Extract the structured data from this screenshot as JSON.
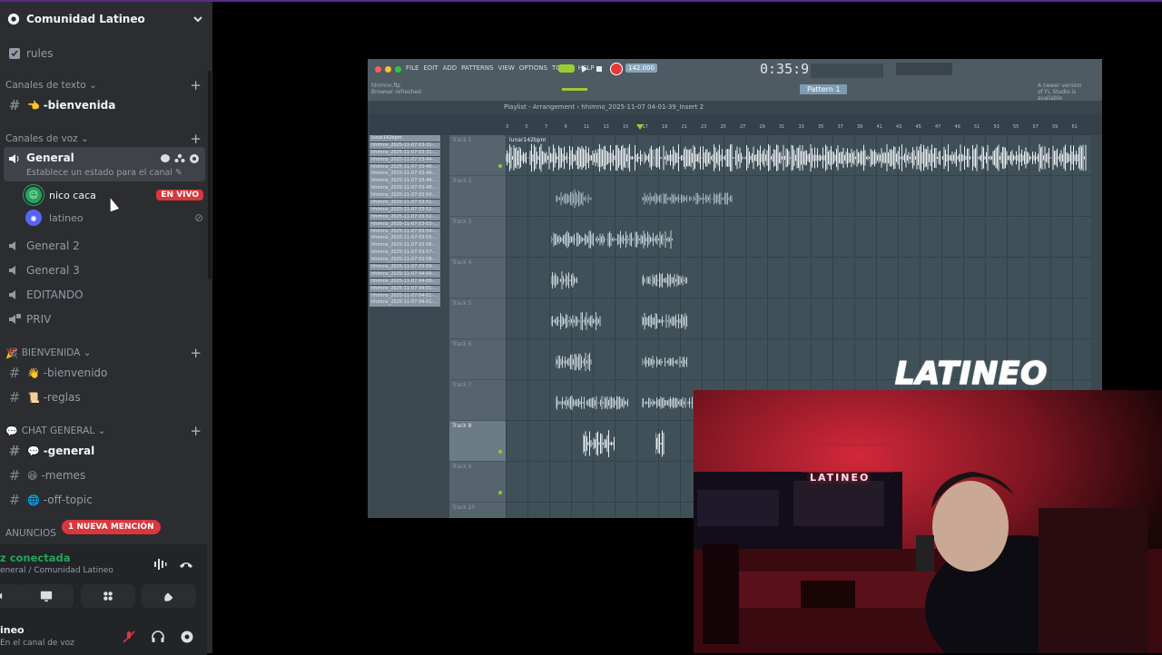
{
  "server": {
    "name": "Comunidad Latineo"
  },
  "channels": {
    "rules": "rules",
    "cat_text": "Canales de texto",
    "bienvenida": "-bienvenida",
    "cat_voice": "Canales de voz",
    "general": "General",
    "general_status": "Establece un estado para el canal",
    "voice_users": [
      {
        "name": "nico caca",
        "badge": "EN VIVO"
      },
      {
        "name": "latineo"
      }
    ],
    "general2": "General 2",
    "general3": "General 3",
    "editando": "EDITANDO",
    "priv": "PRIV",
    "cat_bienvenida": "BIENVENIDA",
    "bienvenido": "-bienvenido",
    "reglas": "-reglas",
    "cat_chat": "CHAT GENERAL",
    "general_text": "-general",
    "memes": "-memes",
    "offtopic": "-off-topic",
    "cat_anuncios": "ANUNCIOS",
    "mention": "1 NUEVA MENCIÓN"
  },
  "voice_panel": {
    "status": "z conectada",
    "location": "eneral / Comunidad Latineo"
  },
  "user_panel": {
    "name": "ineo",
    "status": "En el canal de voz"
  },
  "fl": {
    "menu": [
      "FILE",
      "EDIT",
      "ADD",
      "PATTERNS",
      "VIEW",
      "OPTIONS",
      "TOOLS",
      "HELP"
    ],
    "bpm": "142.000",
    "time": "0:35:91",
    "pattern": "Pattern 1",
    "browser_line1": "hhimno.flp",
    "browser_line2": "Browser refreshed",
    "newver_line1": "A newer version",
    "newver_line2": "of FL Studio is available",
    "playlist_title": "Playlist - Arrangement  ›  hhimno_2025-11-07 04-01-39_Insert 2",
    "ruler": [
      "3",
      "5",
      "7",
      "9",
      "11",
      "13",
      "15",
      "17",
      "19",
      "21",
      "23",
      "25",
      "27",
      "29",
      "31",
      "33",
      "35",
      "37",
      "39",
      "41",
      "43",
      "45",
      "47",
      "49",
      "51",
      "53",
      "55",
      "57",
      "59",
      "61"
    ],
    "tracks": [
      "Track 1",
      "Track 2",
      "Track 3",
      "Track 4",
      "Track 5",
      "Track 6",
      "Track 7",
      "Track 8",
      "Track 9",
      "Track 10"
    ],
    "selected_track": "Track 8",
    "clip_top": "lunar142bpm",
    "patterns": [
      "lunar142bpm",
      "hhimno_2025-11-07 03-31-...",
      "hhimno_2025-11-07 03-31-...",
      "hhimno_2025-11-07 03-44-...",
      "hhimno_2025-11-07 03-46-...",
      "hhimno_2025-11-07 03-46-...",
      "hhimno_2025-11-07 03-49-...",
      "hhimno_2025-11-07 03-48-...",
      "hhimno_2025-11-07 03-50-...",
      "hhimno_2025-11-07 03-51-...",
      "hhimno_2025-11-07 03-52-...",
      "hhimno_2025-11-07 03-52-...",
      "hhimno_2025-11-07 03-53-...",
      "hhimno_2025-11-07 03-54-...",
      "hhimno_2025-11-07 03-55-...",
      "hhimno_2025-11-07 03-56-...",
      "hhimno_2025-11-07 03-57-...",
      "hhimno_2025-11-07 03-58-...",
      "hhimno_2025-11-07 03-59-...",
      "hhimno_2025-11-07 04-00-...",
      "hhimno_2025-11-07 04-00-...",
      "hhimno_2025-11-07 04-01-...",
      "hhimno_2025-11-07 04-01-...",
      "hhimno_2025-11-07 04-01-..."
    ]
  },
  "overlay": {
    "logo": "LATINEO",
    "neon_sign": "LATINEO"
  },
  "colors": {
    "sidebar": "#2b2d31",
    "live": "#da373c",
    "connected": "#23a55a"
  }
}
